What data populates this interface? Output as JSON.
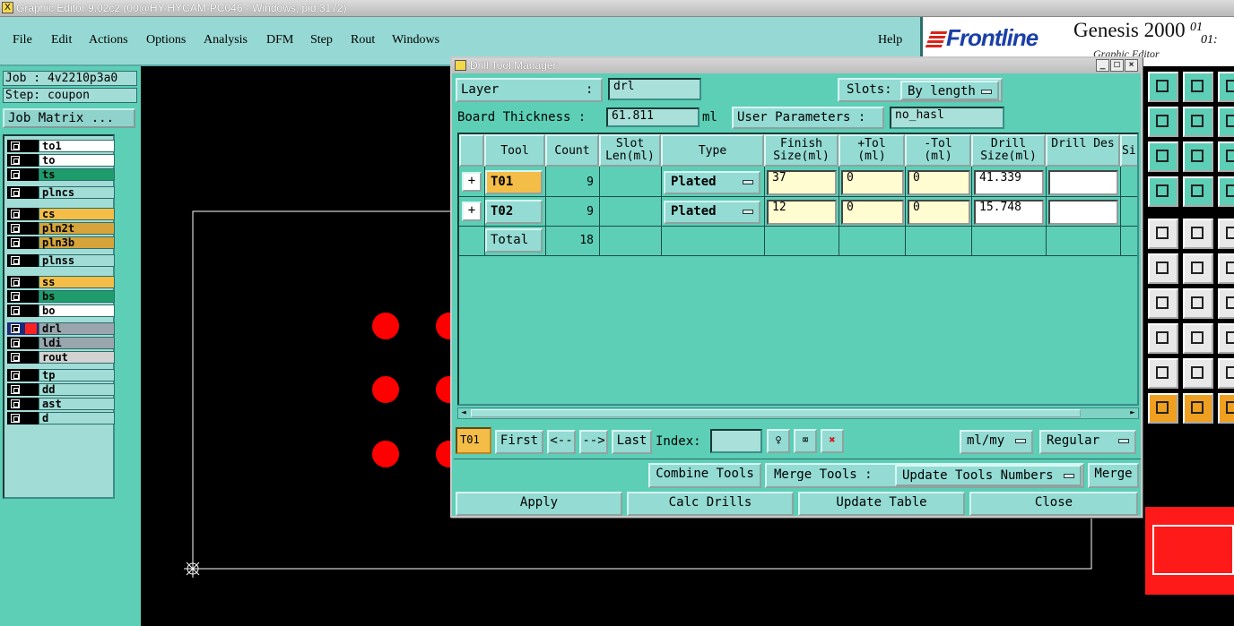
{
  "window": {
    "title": "Graphic Editor 9.02c2 (00@HY-HYCAM-PC046 - Windows, pid:3172)"
  },
  "menubar": {
    "items": [
      "File",
      "Edit",
      "Actions",
      "Options",
      "Analysis",
      "DFM",
      "Step",
      "Rout",
      "Windows"
    ],
    "help": "Help"
  },
  "brand": {
    "logo": "Frontline",
    "product": "Genesis 2000",
    "subtitle": "Graphic Editor",
    "version1": "01",
    "version2": "01:"
  },
  "job": {
    "job_label": "Job : 4v2210p3a0",
    "step_label": "Step: coupon",
    "matrix_button": "Job Matrix ..."
  },
  "layers": [
    {
      "name": "to1",
      "color": "#ffffff",
      "group": 1
    },
    {
      "name": "to",
      "color": "#ffffff",
      "group": 1
    },
    {
      "name": "ts",
      "color": "#1e9c6c",
      "group": 1
    },
    {
      "name": "plncs",
      "color": "#a2dcd6",
      "group": 2
    },
    {
      "name": "cs",
      "color": "#f4bd48",
      "group": 3
    },
    {
      "name": "pln2t",
      "color": "#d6a43a",
      "group": 3
    },
    {
      "name": "pln3b",
      "color": "#d6a43a",
      "group": 3
    },
    {
      "name": "plnss",
      "color": "#a2dcd6",
      "group": 4
    },
    {
      "name": "ss",
      "color": "#f4bd48",
      "group": 5
    },
    {
      "name": "bs",
      "color": "#1e9c6c",
      "group": 5
    },
    {
      "name": "bo",
      "color": "#ffffff",
      "group": 5
    },
    {
      "name": "drl",
      "color": "#9aa6ad",
      "group": 6
    },
    {
      "name": "ldi",
      "color": "#9aa6ad",
      "group": 6
    },
    {
      "name": "rout",
      "color": "#d2d2d2",
      "group": 6
    },
    {
      "name": "tp",
      "color": "#a2dcd6",
      "group": 7
    },
    {
      "name": "dd",
      "color": "#a2dcd6",
      "group": 7
    },
    {
      "name": "ast",
      "color": "#a2dcd6",
      "group": 7
    },
    {
      "name": "d",
      "color": "#a2dcd6",
      "group": 7
    }
  ],
  "dialog": {
    "title": "Drill Tool Manager",
    "layer_label": "Layer",
    "layer_colon": ":",
    "layer_value": "drl",
    "slots_label": "Slots:",
    "slots_value": "By length",
    "thickness_label": "Board Thickness :",
    "thickness_value": "61.811",
    "thickness_unit": "ml",
    "user_params_label": "User Parameters :",
    "user_params_value": "no_hasl",
    "columns": [
      "Tool",
      "Count",
      "Slot Len(ml)",
      "Type",
      "Finish Size(ml)",
      "+Tol (ml)",
      "-Tol (ml)",
      "Drill Size(ml)",
      "Drill Des",
      "Si"
    ],
    "rows": [
      {
        "tool": "T01",
        "count": "9",
        "type": "Plated",
        "finish": "37",
        "ptol": "0",
        "ntol": "0",
        "drill": "41.339",
        "des": ""
      },
      {
        "tool": "T02",
        "count": "9",
        "type": "Plated",
        "finish": "12",
        "ptol": "0",
        "ntol": "0",
        "drill": "15.748",
        "des": ""
      }
    ],
    "total_label": "Total",
    "total_count": "18",
    "current_tool": "T01",
    "nav": {
      "first": "First",
      "prev": "<--",
      "next": "-->",
      "last": "Last",
      "index_label": "Index:",
      "index_value": ""
    },
    "units": "ml/my",
    "mode": "Regular",
    "combine": "Combine Tools",
    "merge_label": "Merge Tools :",
    "update_numbers": "Update Tools Numbers",
    "merge": "Merge",
    "apply": "Apply",
    "calc": "Calc Drills",
    "update_table": "Update Table",
    "close": "Close"
  },
  "colors": {
    "accent": "#5ccfb6",
    "pad": "#ff0000",
    "active_tool": "#f4bd48"
  },
  "icons": [
    "move-up-icon",
    "move-down-icon",
    "add-left-icon",
    "add-right-icon",
    "fit-icon",
    "pan-icon",
    "snap-icon",
    "grid-icon",
    "pad-icon",
    "line-edit-icon",
    "connect-icon",
    "cross-icon",
    "angle-icon",
    "slash-icon",
    "node-icon",
    "minus-icon",
    "triangle-icon",
    "arc-icon",
    "cursor-icon",
    "select-cursor-icon"
  ]
}
